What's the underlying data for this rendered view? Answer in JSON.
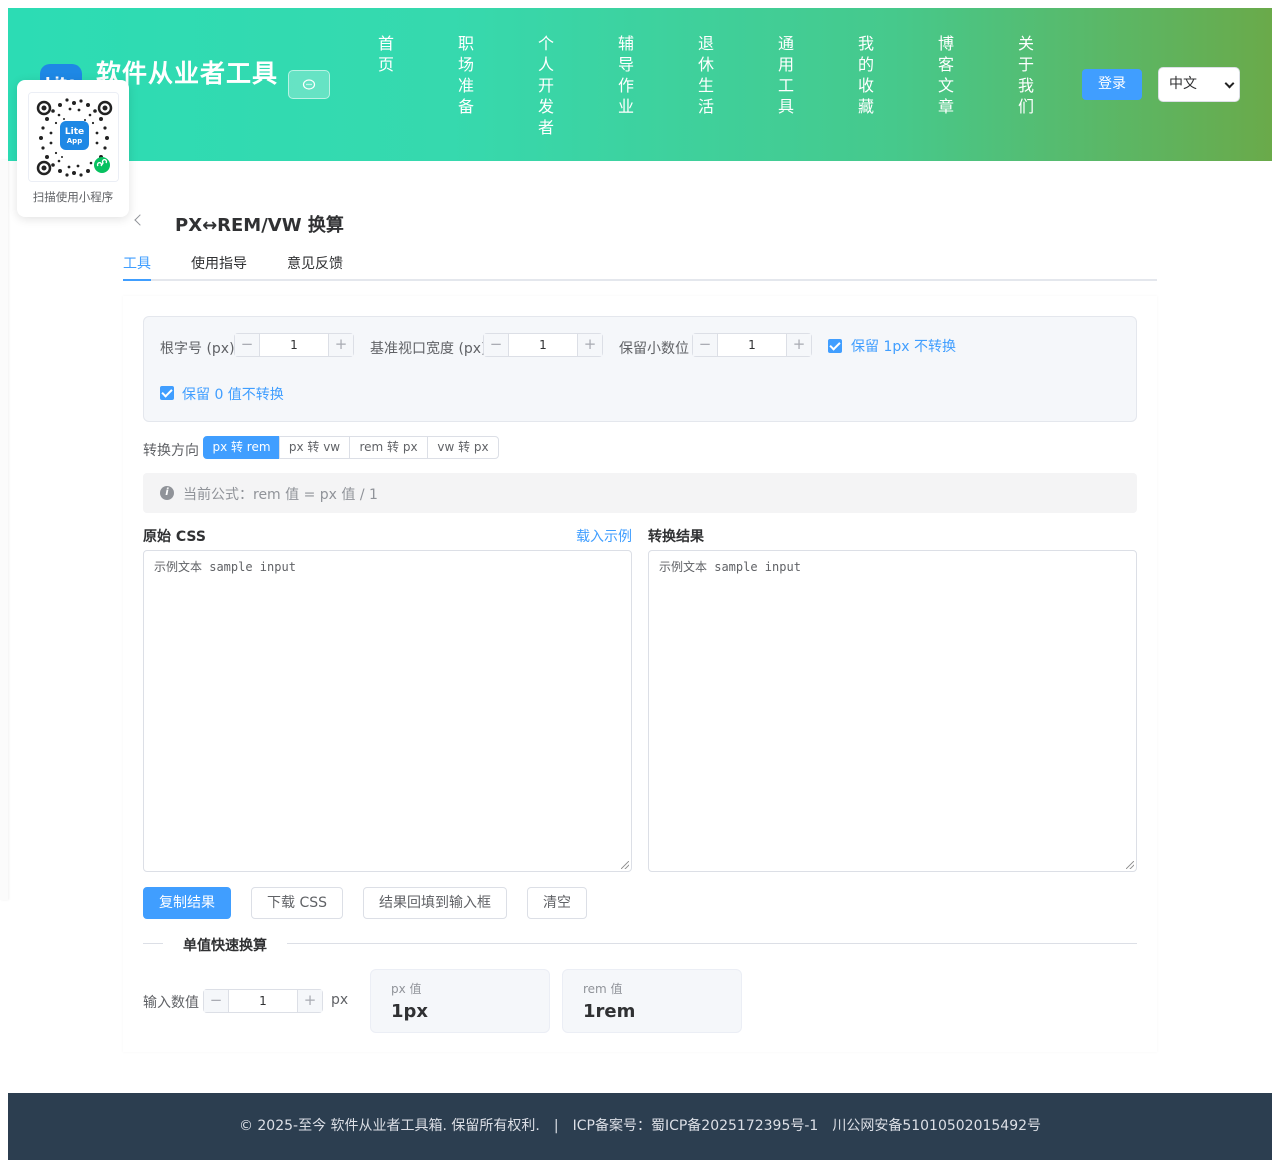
{
  "header": {
    "logo_text": "Lite",
    "brand": "软件从业者工具",
    "nav": [
      "首页",
      "职场准备",
      "个人开发者",
      "辅导作业",
      "退休生活",
      "通用工具",
      "我的收藏",
      "博客文章",
      "关于我们"
    ],
    "login_label": "登录",
    "language": "中文"
  },
  "qr": {
    "badge_line1": "Lite",
    "badge_line2": "App",
    "caption": "扫描使用小程序"
  },
  "page": {
    "title": "PX↔REM/VW 换算",
    "tabs": [
      "工具",
      "使用指导",
      "意见反馈"
    ],
    "active_tab": "工具"
  },
  "settings": {
    "root_font_label": "根字号 (px)",
    "root_font_value": "1",
    "viewport_label": "基准视口宽度 (px)",
    "viewport_value": "1",
    "decimals_label": "保留小数位",
    "decimals_value": "1",
    "keep_1px_label": "保留 1px 不转换",
    "keep_1px_checked": true,
    "keep_zero_label": "保留 0 值不转换",
    "keep_zero_checked": true
  },
  "direction": {
    "label": "转换方向",
    "options": [
      "px 转 rem",
      "px 转 vw",
      "rem 转 px",
      "vw 转 px"
    ],
    "selected": "px 转 rem"
  },
  "formula": {
    "text": "当前公式：rem 值 = px 值 / 1"
  },
  "editor": {
    "source_label": "原始 CSS",
    "load_example": "载入示例",
    "result_label": "转换结果",
    "source_text": "示例文本 sample input",
    "result_text": "示例文本 sample input"
  },
  "actions": {
    "copy": "复制结果",
    "download": "下载 CSS",
    "fill_back": "结果回填到输入框",
    "clear": "清空"
  },
  "quick": {
    "divider": "单值快速换算",
    "input_label": "输入数值",
    "input_value": "1",
    "unit": "px",
    "px_key": "px 值",
    "px_val": "1px",
    "rem_key": "rem 值",
    "rem_val": "1rem"
  },
  "footer": {
    "text": "© 2025-至今 软件从业者工具箱. 保留所有权利.　|　ICP备案号：蜀ICP备2025172395号-1　川公网安备51010502015492号"
  },
  "colors": {
    "accent": "#409eff",
    "header_start": "#2cdcb4",
    "header_end": "#6aaa4a",
    "footer_bg": "#2c3e50"
  }
}
